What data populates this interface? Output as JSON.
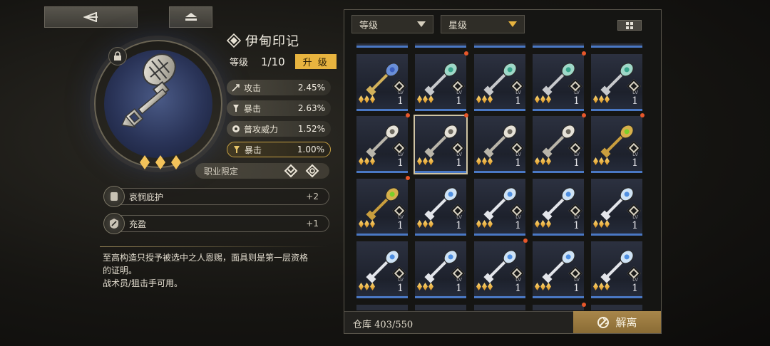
{
  "nav": {
    "back_icon": "back-arrow-icon",
    "menu_icon": "eject-menu-icon"
  },
  "item": {
    "name": "伊甸印记",
    "level_label": "等级",
    "level_value": "1/10",
    "upgrade_label": "升 级",
    "stars": 3,
    "stats": [
      {
        "name": "攻击",
        "value": "2.45%",
        "icon": "attack-arrow-icon"
      },
      {
        "name": "暴击",
        "value": "2.63%",
        "icon": "crit-icon"
      },
      {
        "name": "普攻威力",
        "value": "1.52%",
        "icon": "basic-attack-icon"
      },
      {
        "name": "暴击",
        "value": "1.00%",
        "icon": "crit-icon"
      }
    ],
    "class_limit_label": "职业限定",
    "skills": [
      {
        "name": "哀悯庇护",
        "value": "+2"
      },
      {
        "name": "充盈",
        "value": "+1"
      }
    ],
    "description": [
      "至高构造只授予被选中之人恩赐，面具则是第一层资格",
      "的证明。",
      "战术员/狙击手可用。"
    ]
  },
  "inventory": {
    "filter_level": "等级",
    "filter_star": "星级",
    "storage_label": "仓库",
    "storage_count": "403/550",
    "dismantle_label": "解离",
    "lv_label": "LV",
    "accent_color": "#e8b43f",
    "rarity_color": "#4a78c4",
    "items": [
      {
        "type": "gold-blue",
        "level": "1",
        "new": false,
        "selected": false
      },
      {
        "type": "silver-teal",
        "level": "1",
        "new": true,
        "selected": false
      },
      {
        "type": "silver-teal",
        "level": "1",
        "new": false,
        "selected": false
      },
      {
        "type": "silver-teal",
        "level": "1",
        "new": true,
        "selected": false
      },
      {
        "type": "silver-teal",
        "level": "1",
        "new": false,
        "selected": false
      },
      {
        "type": "eden-mark",
        "level": "1",
        "new": true,
        "selected": false
      },
      {
        "type": "eden-mark",
        "level": "1",
        "new": true,
        "selected": true
      },
      {
        "type": "eden-mark",
        "level": "1",
        "new": false,
        "selected": false
      },
      {
        "type": "eden-mark",
        "level": "1",
        "new": true,
        "selected": false
      },
      {
        "type": "gold-green",
        "level": "1",
        "new": true,
        "selected": false
      },
      {
        "type": "gold-green",
        "level": "1",
        "new": true,
        "selected": false
      },
      {
        "type": "silver-blue",
        "level": "1",
        "new": false,
        "selected": false
      },
      {
        "type": "silver-blue",
        "level": "1",
        "new": false,
        "selected": false
      },
      {
        "type": "silver-blue",
        "level": "1",
        "new": false,
        "selected": false
      },
      {
        "type": "silver-blue",
        "level": "1",
        "new": false,
        "selected": false
      },
      {
        "type": "silver-blue",
        "level": "1",
        "new": false,
        "selected": false
      },
      {
        "type": "silver-blue",
        "level": "1",
        "new": false,
        "selected": false
      },
      {
        "type": "silver-blue",
        "level": "1",
        "new": true,
        "selected": false
      },
      {
        "type": "silver-blue",
        "level": "1",
        "new": false,
        "selected": false
      },
      {
        "type": "silver-blue",
        "level": "1",
        "new": false,
        "selected": false
      }
    ]
  }
}
